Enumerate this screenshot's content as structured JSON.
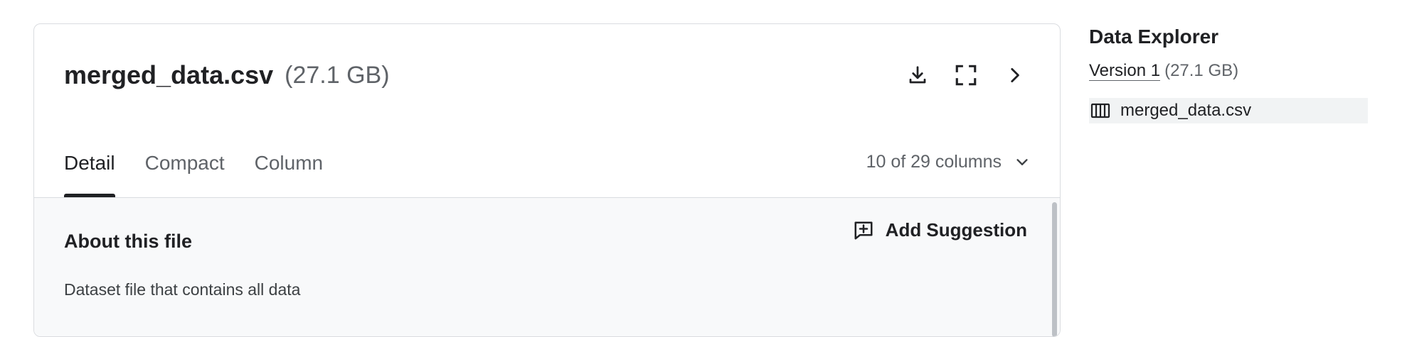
{
  "file": {
    "name": "merged_data.csv",
    "size": "(27.1 GB)"
  },
  "header_actions": {
    "icons": [
      "download-icon",
      "fullscreen-icon",
      "chevron-right-icon"
    ]
  },
  "tabs": [
    {
      "label": "Detail",
      "active": true
    },
    {
      "label": "Compact",
      "active": false
    },
    {
      "label": "Column",
      "active": false
    }
  ],
  "columns_selector": {
    "label": "10 of 29 columns",
    "icon": "chevron-down-icon"
  },
  "about": {
    "title": "About this file",
    "description": "Dataset file that contains all data",
    "suggestion_button": "Add Suggestion",
    "suggestion_icon": "comment-add-icon"
  },
  "sidebar": {
    "title": "Data Explorer",
    "version_label": "Version 1",
    "version_size": "(27.1 GB)",
    "files": [
      {
        "name": "merged_data.csv",
        "icon": "table-columns-icon",
        "selected": true
      }
    ]
  },
  "colors": {
    "text_primary": "#202124",
    "text_secondary": "#5f6368",
    "border": "#dadce0",
    "content_bg": "#f8f9fa",
    "selected_bg": "#f1f3f4"
  }
}
